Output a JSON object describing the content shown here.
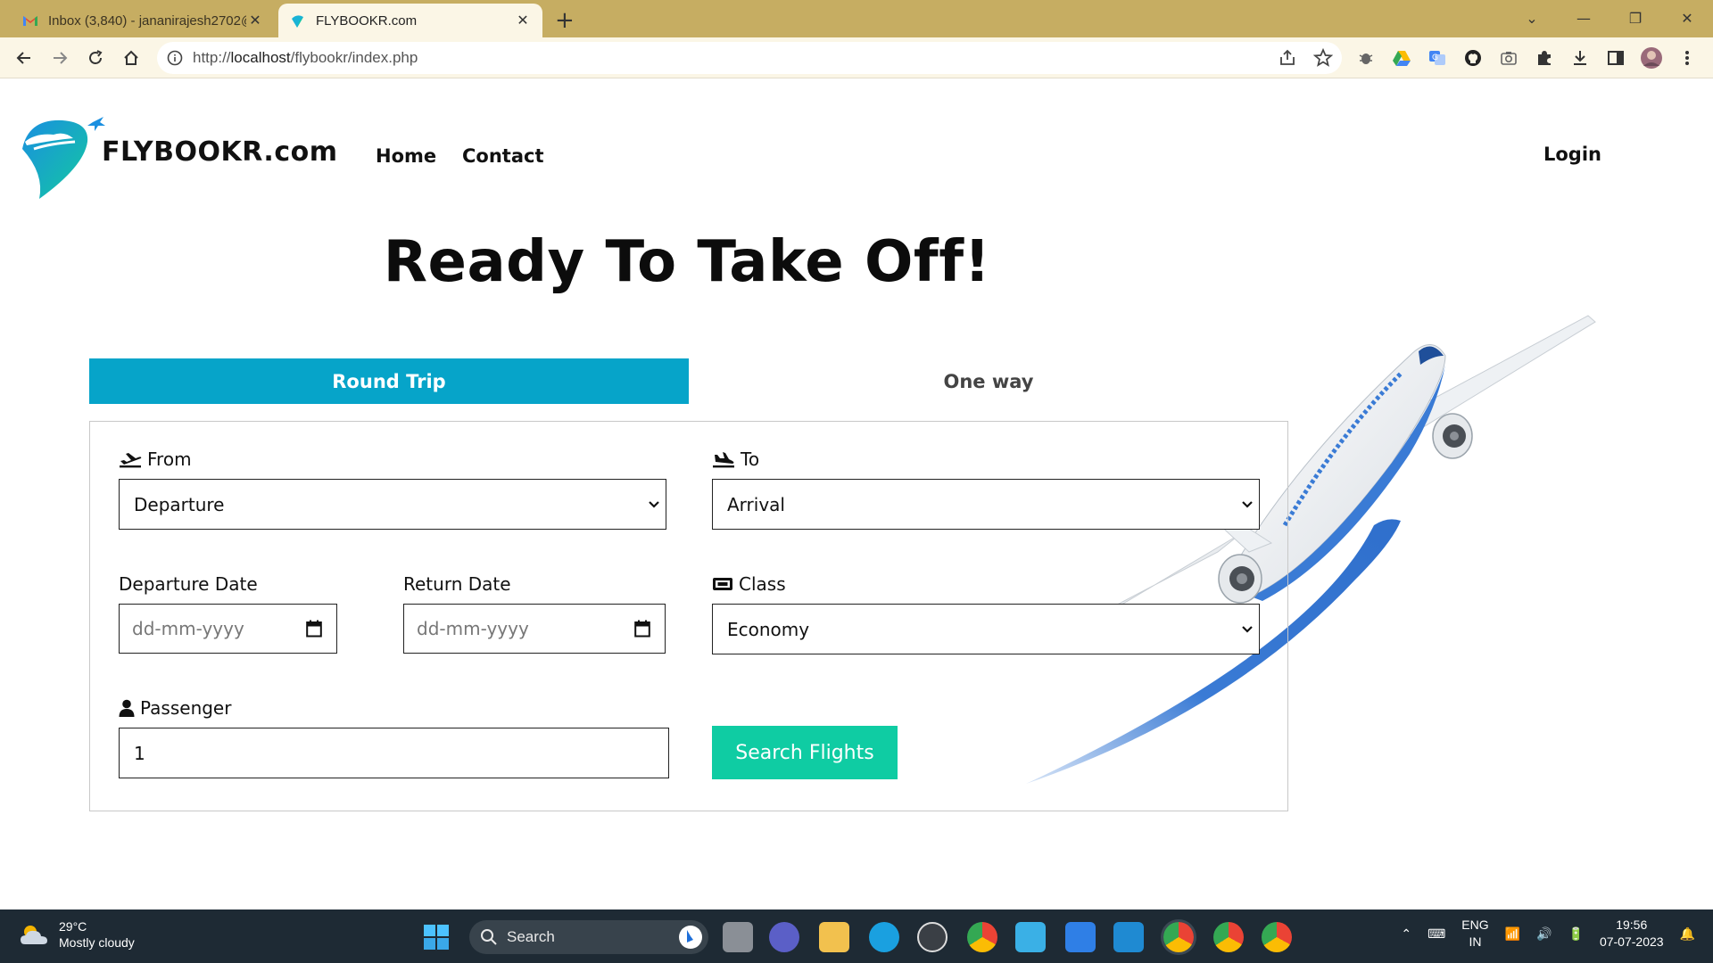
{
  "browser": {
    "tabs": [
      {
        "title": "Inbox (3,840) - jananirajesh2702@",
        "active": false
      },
      {
        "title": "FLYBOOKR.com",
        "active": true
      }
    ],
    "url_prefix": "http://",
    "url_host": "localhost",
    "url_path": "/flybookr/index.php"
  },
  "site": {
    "brand": "FLYBOOKR.com",
    "nav": {
      "home": "Home",
      "contact": "Contact",
      "login": "Login"
    },
    "hero": "Ready To Take Off!",
    "trip_tabs": {
      "round": "Round Trip",
      "oneway": "One way"
    },
    "form": {
      "from_label": "From",
      "from_value": "Departure",
      "to_label": "To",
      "to_value": "Arrival",
      "departure_date_label": "Departure Date",
      "departure_date_placeholder": "dd-mm-yyyy",
      "return_date_label": "Return Date",
      "return_date_placeholder": "dd-mm-yyyy",
      "class_label": "Class",
      "class_value": "Economy",
      "passenger_label": "Passenger",
      "passenger_value": "1",
      "search_button": "Search Flights"
    }
  },
  "taskbar": {
    "weather_temp": "29°C",
    "weather_desc": "Mostly cloudy",
    "search_label": "Search",
    "lang_1": "ENG",
    "lang_2": "IN",
    "time": "19:56",
    "date": "07-07-2023"
  },
  "colors": {
    "tabbar": "#c6ad62",
    "accent_tab": "#06a4c9",
    "search_button": "#0fcca3",
    "plane_blue": "#3a7bd5"
  }
}
